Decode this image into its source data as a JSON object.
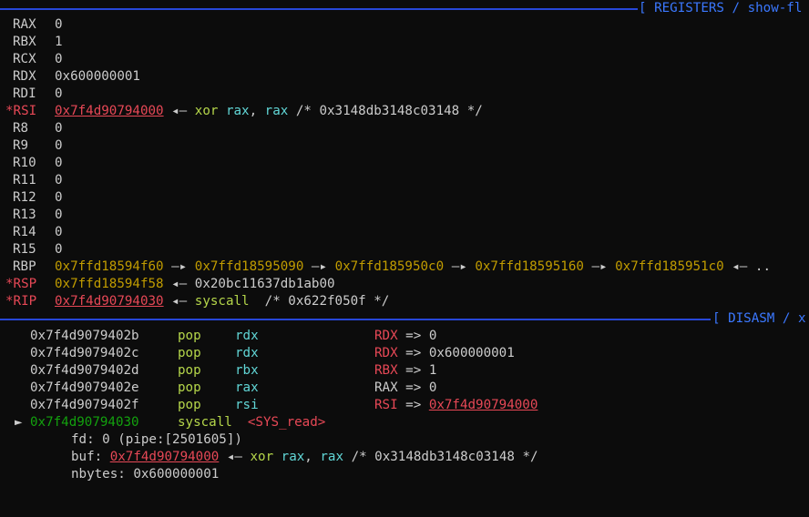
{
  "registers_header": "[ REGISTERS / show-fl",
  "disasm_header": "[ DISASM / x",
  "registers": [
    {
      "name": "RAX",
      "value": "0"
    },
    {
      "name": "RBX",
      "value": "1"
    },
    {
      "name": "RCX",
      "value": "0"
    },
    {
      "name": "RDX",
      "value": "0x600000001"
    },
    {
      "name": "RDI",
      "value": "0"
    },
    {
      "name": "*RSI",
      "value": "0x7f4d90794000",
      "arrow": "◂—",
      "instr": "xor",
      "op1": "rax",
      "op2": "rax",
      "comment": "/* 0x3148db3148c03148 */"
    },
    {
      "name": "R8",
      "value": "0"
    },
    {
      "name": "R9",
      "value": "0"
    },
    {
      "name": "R10",
      "value": "0"
    },
    {
      "name": "R11",
      "value": "0"
    },
    {
      "name": "R12",
      "value": "0"
    },
    {
      "name": "R13",
      "value": "0"
    },
    {
      "name": "R14",
      "value": "0"
    },
    {
      "name": "R15",
      "value": "0"
    },
    {
      "name": "RBP",
      "chain": [
        "0x7ffd18594f60",
        "0x7ffd18595090",
        "0x7ffd185950c0",
        "0x7ffd18595160",
        "0x7ffd185951c0"
      ],
      "arrow": "—▸",
      "tail_arrow": "◂—",
      "tail": ".."
    },
    {
      "name": "*RSP",
      "value": "0x7ffd18594f58",
      "arrow": "◂—",
      "target": "0x20bc11637db1ab00"
    },
    {
      "name": "*RIP",
      "value": "0x7f4d90794030",
      "arrow": "◂—",
      "instr": "syscall",
      "comment": "/* 0x622f050f */"
    }
  ],
  "disasm": [
    {
      "addr": "0x7f4d9079402b",
      "mnem": "pop",
      "op": "rdx",
      "effect_reg": "RDX",
      "effect_arrow": "=>",
      "effect_val": "0"
    },
    {
      "addr": "0x7f4d9079402c",
      "mnem": "pop",
      "op": "rdx",
      "effect_reg": "RDX",
      "effect_arrow": "=>",
      "effect_val": "0x600000001"
    },
    {
      "addr": "0x7f4d9079402d",
      "mnem": "pop",
      "op": "rbx",
      "effect_reg": "RBX",
      "effect_arrow": "=>",
      "effect_val": "1"
    },
    {
      "addr": "0x7f4d9079402e",
      "mnem": "pop",
      "op": "rax",
      "effect_reg": "RAX",
      "effect_arrow": "=>",
      "effect_val": "0"
    },
    {
      "addr": "0x7f4d9079402f",
      "mnem": "pop",
      "op": "rsi",
      "effect_reg": "RSI",
      "effect_arrow": "=>",
      "effect_val": "0x7f4d90794000"
    },
    {
      "marker": "►",
      "addr": "0x7f4d90794030",
      "mnem": "syscall",
      "op": "<SYS_read>"
    }
  ],
  "syscall_args": {
    "fd_label": "fd:",
    "fd_value": "0 (pipe:[2501605])",
    "buf_label": "buf:",
    "buf_value": "0x7f4d90794000",
    "buf_arrow": "◂—",
    "buf_instr": "xor",
    "buf_op1": "rax",
    "buf_op2": "rax",
    "buf_comment": "/* 0x3148db3148c03148 */",
    "nbytes_label": "nbytes:",
    "nbytes_value": "0x600000001"
  }
}
